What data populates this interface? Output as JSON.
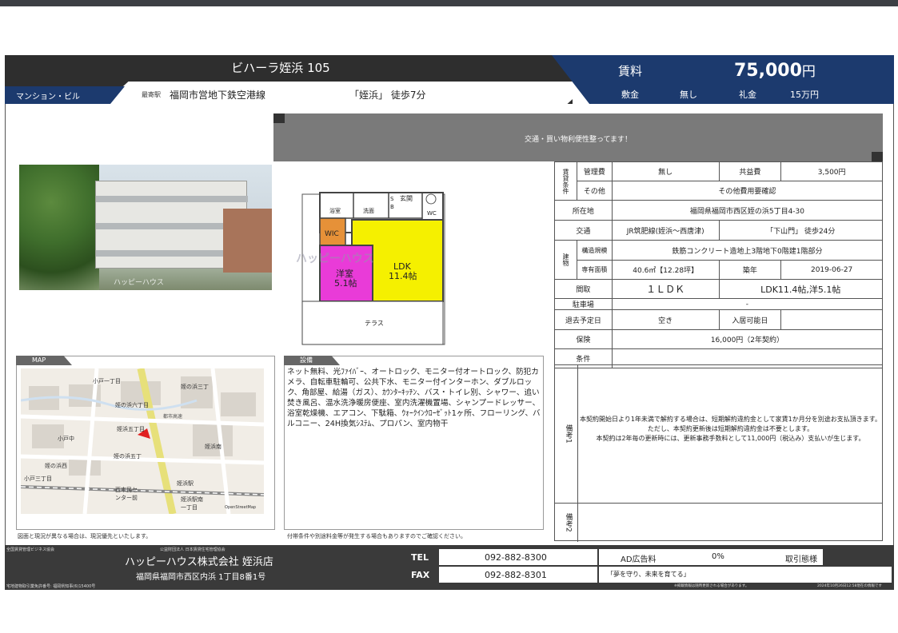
{
  "header": {
    "property_name": "ビハーラ姪浜 105",
    "property_type": "マンション・ビル",
    "nearest_label": "最寄駅",
    "line": "福岡市営地下鉄空港線",
    "station": "「姪浜」 徒歩7分",
    "rent_label": "賃料",
    "rent_value": "75,000",
    "rent_unit": "円",
    "deposit_label": "敷金",
    "deposit_value": "無し",
    "key_money_label": "礼金",
    "key_money_value": "15万円"
  },
  "catchcopy": "交通・買い物利便性整ってます！",
  "photo": {
    "watermark": "ハッピーハウス"
  },
  "floorplan": {
    "rooms": [
      "浴室",
      "洗面",
      "玄関",
      "WC",
      "WIC",
      "S",
      "B",
      "LDK",
      "11.4帖",
      "洋室",
      "5.1帖",
      "テラス"
    ],
    "watermark": "ハッピーハウス",
    "colors": {
      "ldk": "#f5f000",
      "western": "#e93bd8",
      "wic": "#e69138",
      "frame": "#555555"
    }
  },
  "map": {
    "tag": "MAP",
    "labels": [
      "小戸一丁目",
      "姪の浜三丁",
      "姪の浜六丁目",
      "姪浜五丁目",
      "小戸中",
      "姪の浜五丁",
      "姪の浜西",
      "姪浜駅",
      "西市民セ",
      "ンター前",
      "姪浜駅南",
      "一丁目",
      "姪浜南",
      "小戸三丁目",
      "都市高速",
      "OpenStreetMap"
    ],
    "note": "図面と現況が異なる場合は、現況優先といたします。"
  },
  "equipment": {
    "tag": "設備",
    "text": "ネット無料、光ﾌｧｲﾊﾞｰ、オートロック、モニター付オートロック、防犯カメラ、自転車駐輪可、公共下水、モニター付インターホン、ダブルロック、角部屋、給湯（ガス）、ｶｳﾝﾀｰｷｯﾁﾝ、バス・トイレ別、シャワー、追い焚き風呂、温水洗浄暖房便座、室内洗濯機置場、シャンプードレッサー、浴室乾燥機、エアコン、下駄箱、ｳｫｰｸｲﾝｸﾛｰｾﾞｯﾄ1ヶ所、フローリング、バルコニー、24H換気ｼｽﾃﾑ、プロパン、室内物干",
    "note": "付帯条件や別途料金等が発生する場合もありますのでご確認ください。"
  },
  "table": {
    "rent_terms_label": "賃貸条件",
    "mgmt_fee_label": "管理費",
    "mgmt_fee_value": "無し",
    "common_fee_label": "共益費",
    "common_fee_value": "3,500円",
    "other_label": "その他",
    "other_value": "その他費用要確認",
    "address_label": "所在地",
    "address_value": "福岡県福岡市西区姪の浜5丁目4-30",
    "transport_label": "交通",
    "transport_line": "JR筑肥線(姪浜～西唐津)",
    "transport_station": "「下山門」 徒歩24分",
    "building_label": "建物",
    "structure_label": "構造規模",
    "structure_value": "鉄筋コンクリート造地上3階地下0階建1階部分",
    "area_label": "専有面積",
    "area_value": "40.6㎡【12.28坪】",
    "built_label": "築年",
    "built_value": "2019-06-27",
    "layout_label": "間取",
    "layout_value": "１ＬＤＫ",
    "layout_detail": "LDK11.4帖,洋5.1帖",
    "parking_label": "駐車場",
    "parking_value": "-",
    "vacate_label": "退去予定日",
    "vacate_value": "空き",
    "movein_label": "入居可能日",
    "movein_value": "",
    "insurance_label": "保険",
    "insurance_value": "16,000円（2年契約）",
    "conditions_label": "条件",
    "conditions_value": ""
  },
  "remarks": {
    "r1_label": "備考1",
    "r1_text": "本契約開始日より1年未満で解約する場合は、短期解約違約金として家賃1か月分を別途お支払頂きます。ただし、本契約更新後は短期解約違約金は不要とします。\n本契約は2年毎の更新時には、更新事務手数料として11,000円（税込み）支払いが生じます。",
    "r2_label": "備考2"
  },
  "footer": {
    "assoc": "全国賃貸管理ビジネス協会",
    "assoc2": "公益財団法人 日本賃貸住宅管理協会",
    "company": "ハッピーハウス株式会社 姪浜店",
    "address": "福岡県福岡市西区内浜 1丁目8番1号",
    "license": "宅地建物取引業免許番号: 福岡県知事(6)15400号",
    "tel_label": "TEL",
    "tel": "092-882-8300",
    "fax_label": "FAX",
    "fax": "092-882-8301",
    "ad_label": "AD広告料",
    "ad_value": "0%",
    "deal_mode": "取引態様",
    "motto": "「夢を守り、未来を育てる」",
    "notice": "※掲載情報は随時更新される場合があります。",
    "date": "2024年10月26日12:58現在の情報です"
  }
}
